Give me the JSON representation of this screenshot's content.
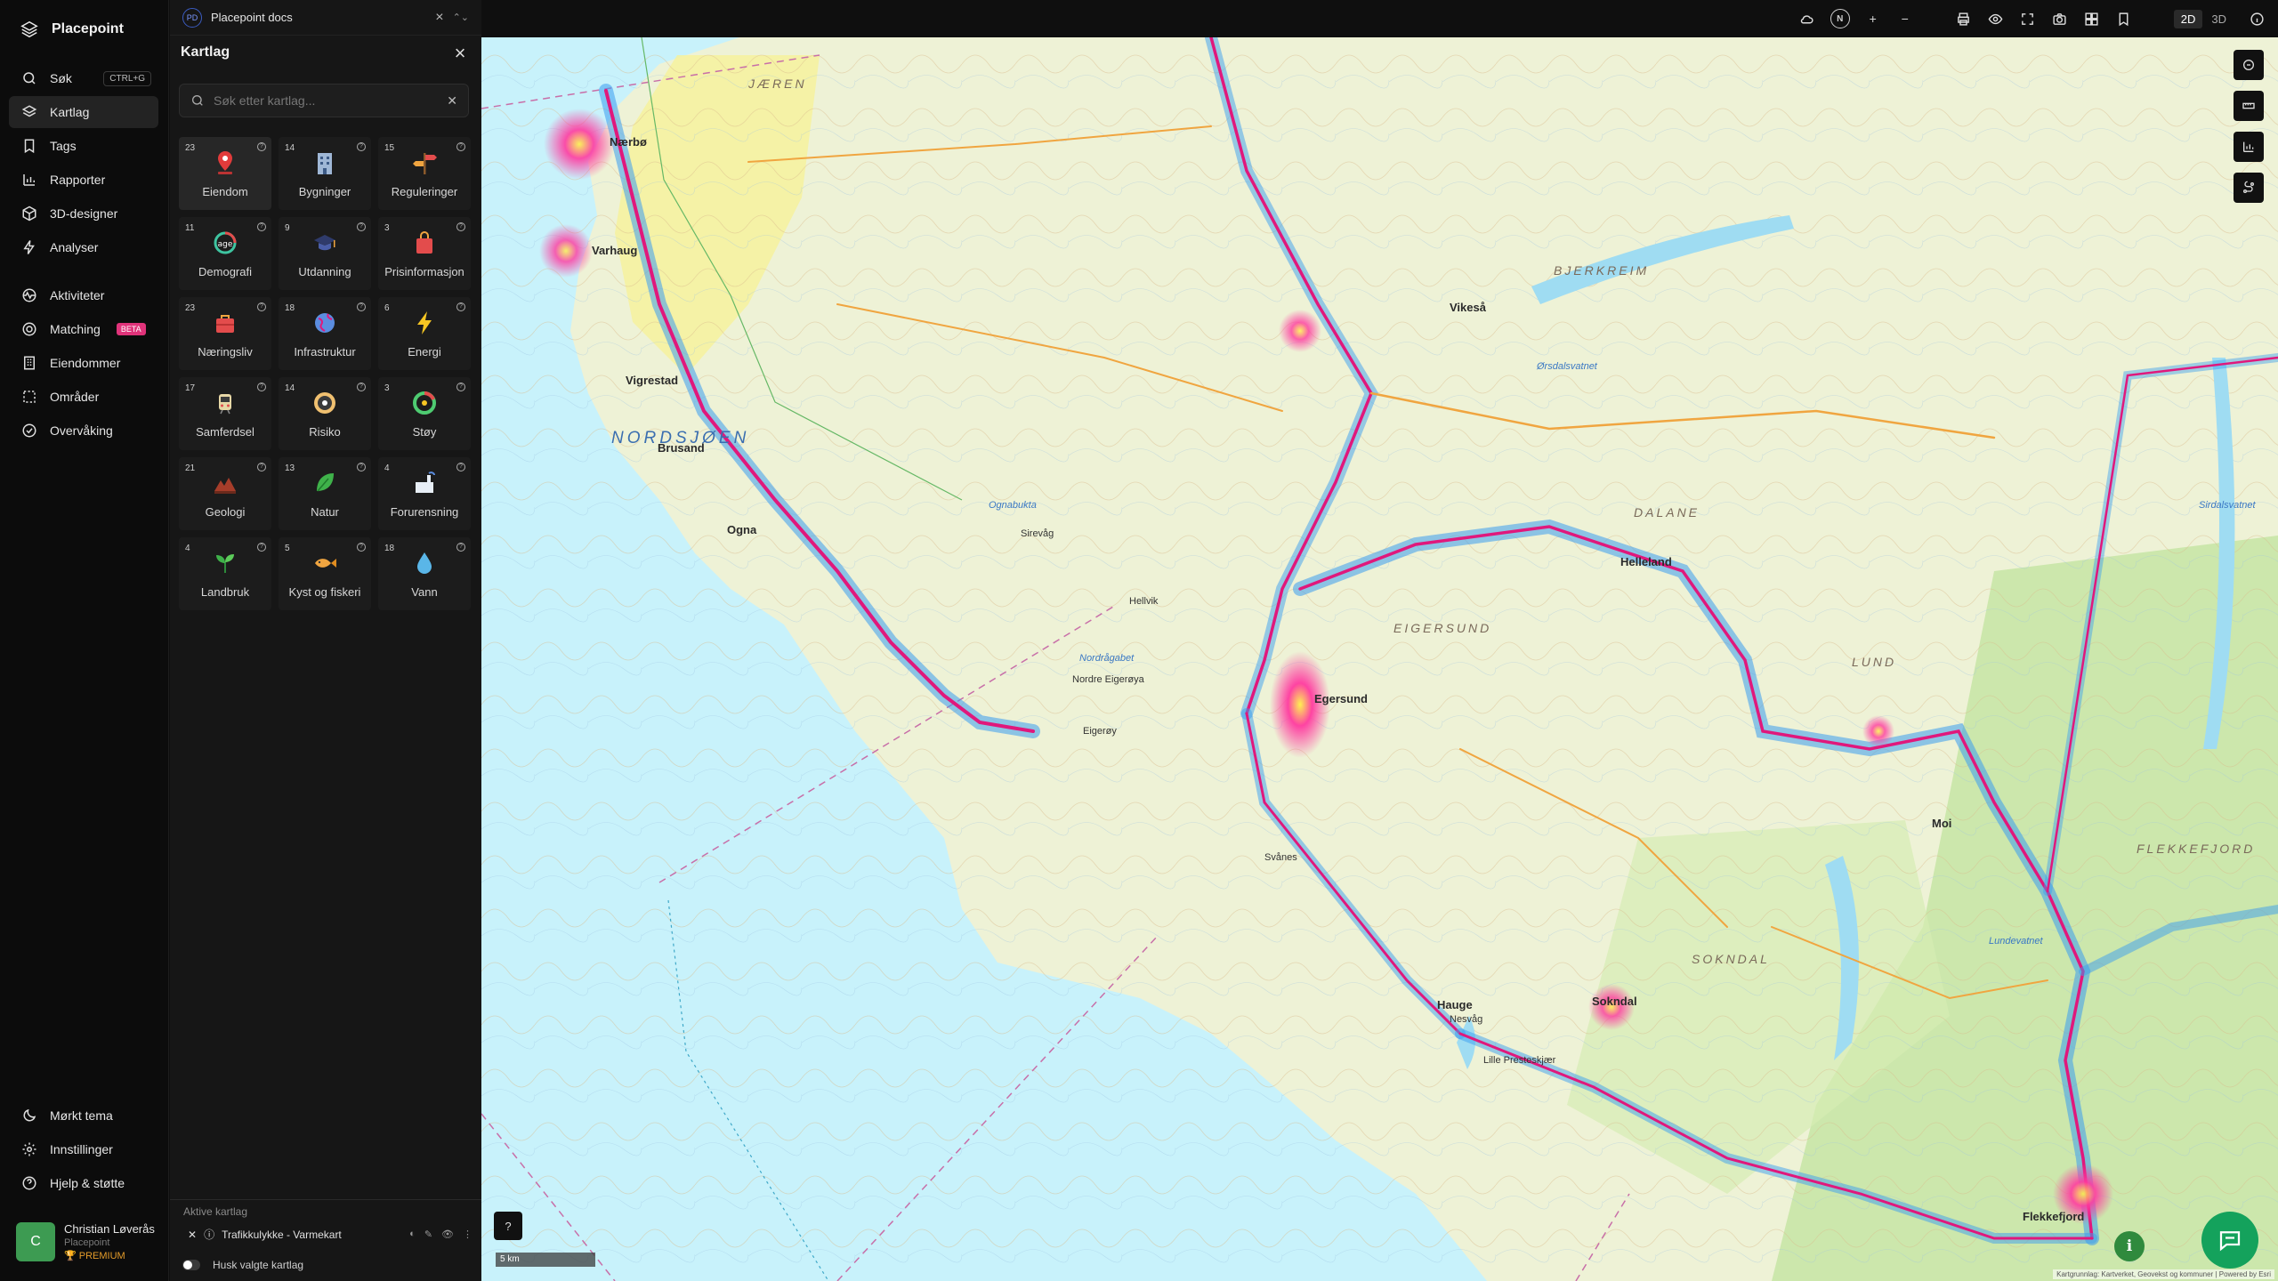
{
  "app": {
    "name": "Placepoint"
  },
  "nav": {
    "items": [
      {
        "label": "Søk",
        "shortcut": "CTRL+G",
        "icon": "search-icon"
      },
      {
        "label": "Kartlag",
        "icon": "layers-icon",
        "active": true
      },
      {
        "label": "Tags",
        "icon": "bookmark-icon"
      },
      {
        "label": "Rapporter",
        "icon": "bar-chart-icon"
      },
      {
        "label": "3D-designer",
        "icon": "cube-icon"
      },
      {
        "label": "Analyser",
        "icon": "bolt-icon"
      },
      {
        "label": "Aktiviteter",
        "icon": "activity-icon"
      },
      {
        "label": "Matching",
        "badge": "BETA",
        "icon": "target-icon"
      },
      {
        "label": "Eiendommer",
        "icon": "building-icon"
      },
      {
        "label": "Områder",
        "icon": "area-icon"
      },
      {
        "label": "Overvåking",
        "icon": "check-circle-icon"
      }
    ],
    "bottom": [
      {
        "label": "Mørkt tema",
        "icon": "moon-icon"
      },
      {
        "label": "Innstillinger",
        "icon": "gear-icon"
      },
      {
        "label": "Hjelp & støtte",
        "icon": "help-icon"
      }
    ]
  },
  "user": {
    "initial": "C",
    "name": "Christian Løverås",
    "org": "Placepoint",
    "tier": "PREMIUM"
  },
  "doc_tab": {
    "badge": "PD",
    "title": "Placepoint docs"
  },
  "panel": {
    "title": "Kartlag",
    "search_placeholder": "Søk etter kartlag...",
    "categories": [
      {
        "count": "23",
        "label": "Eiendom",
        "icon": "location-pin-icon"
      },
      {
        "count": "14",
        "label": "Bygninger",
        "icon": "office-building-icon"
      },
      {
        "count": "15",
        "label": "Reguleringer",
        "icon": "signpost-icon"
      },
      {
        "count": "11",
        "label": "Demografi",
        "icon": "age-gauge-icon"
      },
      {
        "count": "9",
        "label": "Utdanning",
        "icon": "graduation-cap-icon"
      },
      {
        "count": "3",
        "label": "Prisinformasjon",
        "icon": "shopping-bag-icon"
      },
      {
        "count": "23",
        "label": "Næringsliv",
        "icon": "briefcase-icon"
      },
      {
        "count": "18",
        "label": "Infrastruktur",
        "icon": "globe-icon"
      },
      {
        "count": "6",
        "label": "Energi",
        "icon": "lightning-icon"
      },
      {
        "count": "17",
        "label": "Samferdsel",
        "icon": "train-icon"
      },
      {
        "count": "14",
        "label": "Risiko",
        "icon": "risk-dial-icon"
      },
      {
        "count": "3",
        "label": "Støy",
        "icon": "noise-gauge-icon"
      },
      {
        "count": "21",
        "label": "Geologi",
        "icon": "terrain-icon"
      },
      {
        "count": "13",
        "label": "Natur",
        "icon": "leaf-icon"
      },
      {
        "count": "4",
        "label": "Forurensning",
        "icon": "factory-icon"
      },
      {
        "count": "4",
        "label": "Landbruk",
        "icon": "sprout-icon"
      },
      {
        "count": "5",
        "label": "Kyst og fiskeri",
        "icon": "fish-icon"
      },
      {
        "count": "18",
        "label": "Vann",
        "icon": "water-drop-icon"
      }
    ],
    "active_title": "Aktive kartlag",
    "active_layer": "Trafikkulykke - Varmekart",
    "remember_label": "Husk valgte kartlag"
  },
  "topbar": {
    "compass": "N",
    "view_2d": "2D",
    "view_3d": "3D",
    "active_view": "2D"
  },
  "map": {
    "scale": "5 km",
    "attribution": "Kartgrunnlag: Kartverket, Geovekst og kommuner | Powered by Esri",
    "labels": [
      {
        "text": "NORDSJØEN",
        "kind": "sea"
      },
      {
        "text": "JÆREN",
        "kind": "region"
      },
      {
        "text": "DALANE",
        "kind": "region"
      },
      {
        "text": "BJERKREIM",
        "kind": "region"
      },
      {
        "text": "EIGERSUND",
        "kind": "region"
      },
      {
        "text": "SOKNDAL",
        "kind": "region"
      },
      {
        "text": "LUND",
        "kind": "region"
      },
      {
        "text": "FLEKKEFJORD",
        "kind": "region"
      },
      {
        "text": "Nærbø",
        "kind": "town"
      },
      {
        "text": "Varhaug",
        "kind": "town"
      },
      {
        "text": "Vigrestad",
        "kind": "town"
      },
      {
        "text": "Brusand",
        "kind": "town"
      },
      {
        "text": "Ogna",
        "kind": "town"
      },
      {
        "text": "Egersund",
        "kind": "town"
      },
      {
        "text": "Hauge",
        "kind": "town"
      },
      {
        "text": "Sokndal",
        "kind": "town"
      },
      {
        "text": "Flekkefjord",
        "kind": "town"
      },
      {
        "text": "Vikeså",
        "kind": "town"
      },
      {
        "text": "Moi",
        "kind": "town"
      },
      {
        "text": "Helleland",
        "kind": "town"
      },
      {
        "text": "Sirevåg",
        "kind": "place"
      },
      {
        "text": "Hellvik",
        "kind": "place"
      },
      {
        "text": "Eigerøy",
        "kind": "place"
      },
      {
        "text": "Nordre Eigerøya",
        "kind": "place"
      },
      {
        "text": "Svånes",
        "kind": "place"
      },
      {
        "text": "Nesvåg",
        "kind": "place"
      },
      {
        "text": "Lille Presteskjær",
        "kind": "place"
      },
      {
        "text": "Ogna­bukta",
        "kind": "water"
      },
      {
        "text": "Ørsdalsvatnet",
        "kind": "water"
      },
      {
        "text": "Lundevatnet",
        "kind": "water"
      },
      {
        "text": "Sirdalsvatnet",
        "kind": "water"
      },
      {
        "text": "Nordrågabet",
        "kind": "water"
      }
    ]
  }
}
